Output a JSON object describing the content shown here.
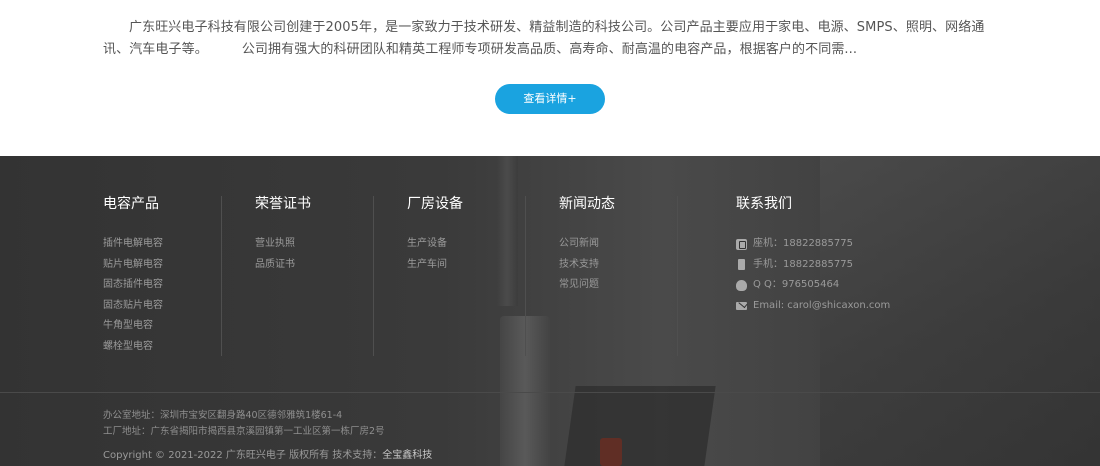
{
  "intro": {
    "paragraph_1": "广东旺兴电子科技有限公司创建于2005年，是一家致力于技术研发、精益制造的科技公司。公司产品主要应用于家电、电源、SMPS、照明、网络通讯、汽车电子等。",
    "paragraph_2": "公司拥有强大的科研团队和精英工程师专项研发高品质、高寿命、耐高温的电容产品，根据客户的不同需...",
    "detail_button": "查看详情+"
  },
  "footer": {
    "columns": [
      {
        "title": "电容产品",
        "items": [
          "插件电解电容",
          "贴片电解电容",
          "固态插件电容",
          "固态贴片电容",
          "牛角型电容",
          "螺栓型电容"
        ]
      },
      {
        "title": "荣誉证书",
        "items": [
          "营业执照",
          "品质证书"
        ]
      },
      {
        "title": "厂房设备",
        "items": [
          "生产设备",
          "生产车间"
        ]
      },
      {
        "title": "新闻动态",
        "items": [
          "公司新闻",
          "技术支持",
          "常见问题"
        ]
      }
    ],
    "contact": {
      "title": "联系我们",
      "items": [
        {
          "icon": "phone-icon",
          "text": "座机：18822885775"
        },
        {
          "icon": "mobile-icon",
          "text": "手机：18822885775"
        },
        {
          "icon": "qq-icon",
          "text": "Q Q：976505464"
        },
        {
          "icon": "mail-icon",
          "text": "Email: carol@shicaxon.com"
        }
      ]
    },
    "office_address": "办公室地址：深圳市宝安区翻身路40区德邻雅筑1楼61-4",
    "factory_address": "工厂地址：广东省揭阳市揭西县京溪园镇第一工业区第一栋厂房2号",
    "copyright": "Copyright © 2021-2022 广东旺兴电子 版权所有  技术支持：",
    "tech_support": "全宝鑫科技"
  },
  "colors": {
    "accent": "#1aa3e0",
    "footer_bg": "#3a3a3a"
  }
}
